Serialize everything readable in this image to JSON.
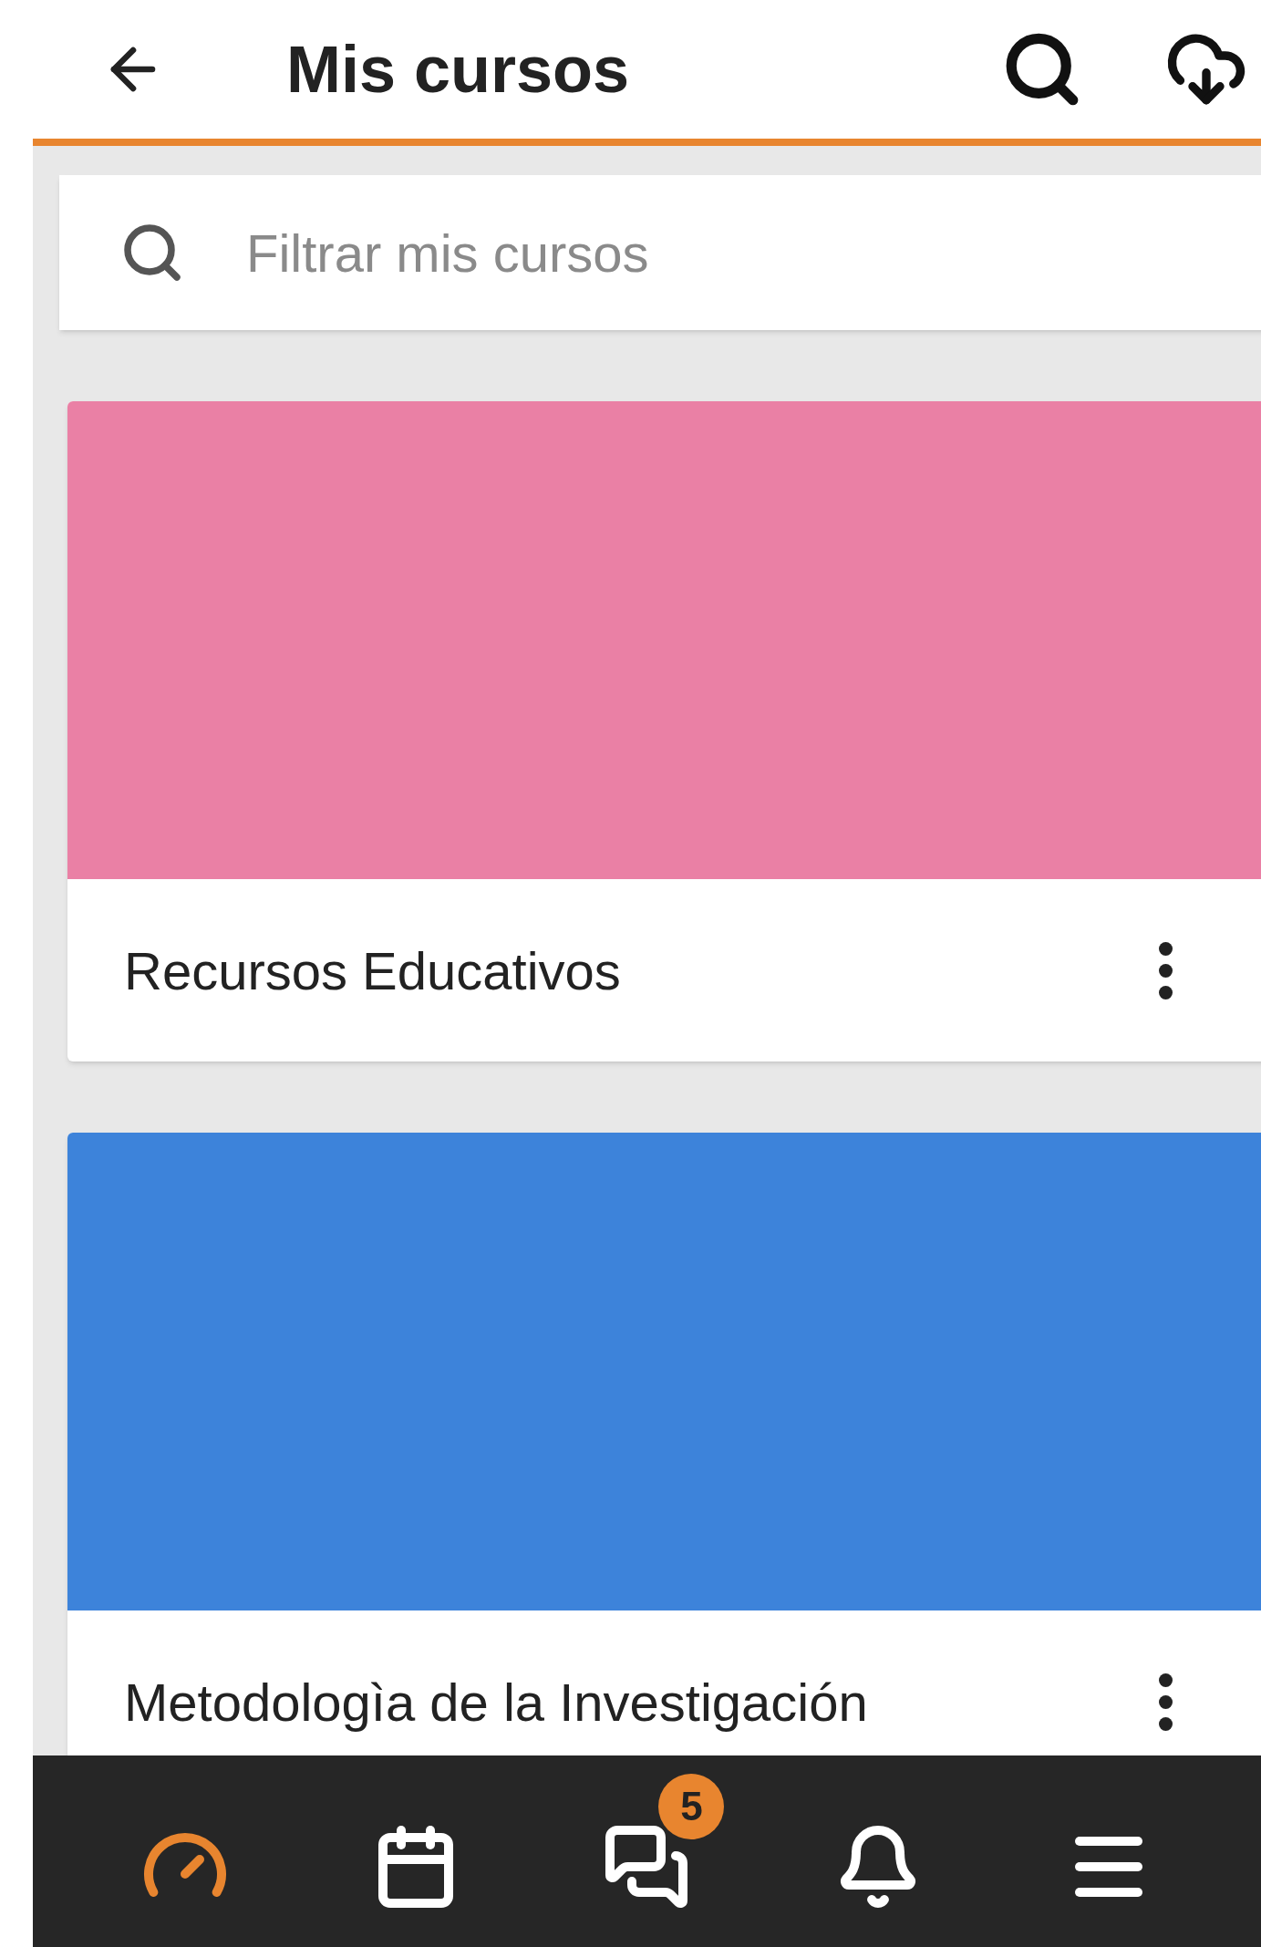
{
  "header": {
    "title": "Mis cursos"
  },
  "search": {
    "placeholder": "Filtrar mis cursos"
  },
  "courses": [
    {
      "title": "Recursos Educativos",
      "color": "#ea80a5"
    },
    {
      "title": "Metodologìa de la Investigación",
      "color": "#3d83da"
    }
  ],
  "bottom_nav": [
    {
      "kind": "dashboard",
      "selected": true
    },
    {
      "kind": "calendar",
      "selected": false
    },
    {
      "kind": "messages",
      "selected": false,
      "badge": "5"
    },
    {
      "kind": "notifications",
      "selected": false
    },
    {
      "kind": "menu",
      "selected": false
    }
  ]
}
